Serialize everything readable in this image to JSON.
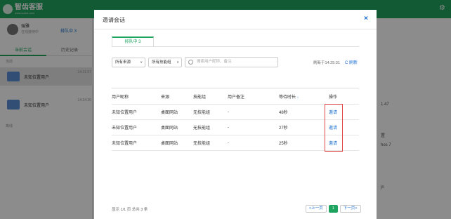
{
  "app": {
    "logo_text": "智齿客服",
    "logo_sub": "www.sobot.com"
  },
  "agent": {
    "name": "瑞雅",
    "status": "在线接待中",
    "queue_label": "排队中 3"
  },
  "left_tabs": [
    "当前会话",
    "历史记录"
  ],
  "left_sections": {
    "current": "当前",
    "offline": "离线"
  },
  "conversations": [
    {
      "name": "未知位置用户",
      "time": "14:21:57"
    },
    {
      "name": "未知位置用户",
      "time": "14:24:20"
    }
  ],
  "right_bg": {
    "items": [
      "1.47",
      "置",
      "hos 7",
      "jn"
    ]
  },
  "modal": {
    "title": "邀请会话",
    "close": "×",
    "tab_label": "排队中 3",
    "filters": {
      "source": "所有来源",
      "group": "所有技能组",
      "search_placeholder": "搜索用户昵称、备注"
    },
    "refresh_time": "刷新于14:25:31",
    "refresh_label": "C 刷新",
    "columns": [
      "用户昵称",
      "来源",
      "技能组",
      "用户备注",
      "等待时长",
      "操作"
    ],
    "sort_icon": "↓",
    "rows": [
      {
        "nickname": "未知位置用户",
        "source": "桌面网站",
        "group": "无技能组",
        "note": "-",
        "wait": "48秒",
        "action": "邀请"
      },
      {
        "nickname": "未知位置用户",
        "source": "桌面网站",
        "group": "无技能组",
        "note": "-",
        "wait": "27秒",
        "action": "邀请"
      },
      {
        "nickname": "未知位置用户",
        "source": "桌面网站",
        "group": "无技能组",
        "note": "-",
        "wait": "25秒",
        "action": "邀请"
      }
    ],
    "footer": "显示 1/1 页  总共 3 条",
    "pager": {
      "prev": "<上一页",
      "current": "1",
      "next": "下一页>"
    }
  },
  "colors": {
    "brand": "#1fa45f",
    "link": "#1a6fd1",
    "highlight": "#e04848"
  }
}
